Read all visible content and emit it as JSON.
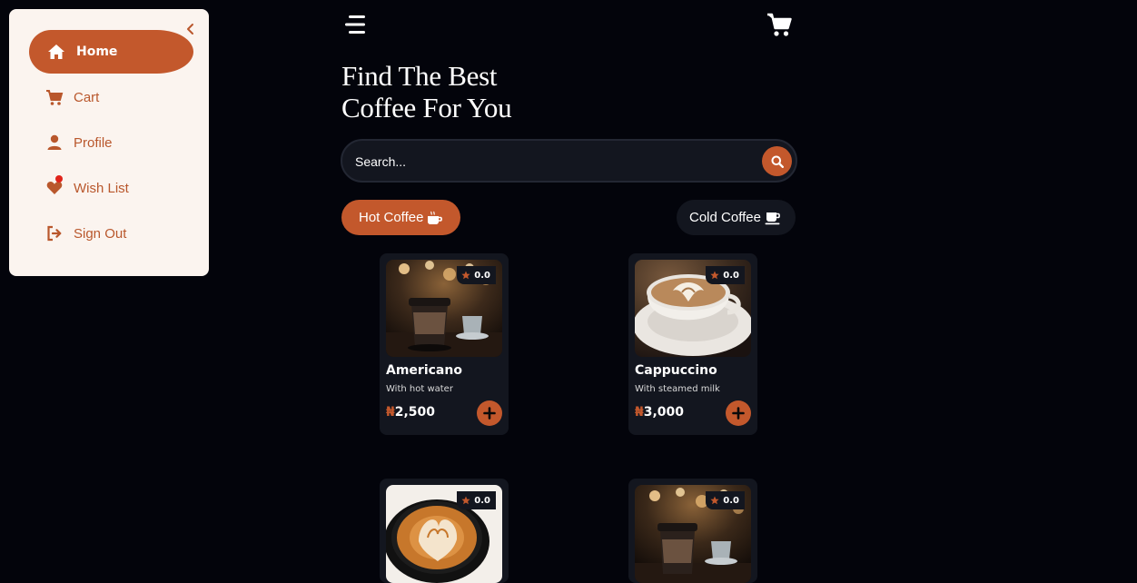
{
  "sidebar": {
    "items": [
      {
        "label": "Home",
        "icon": "home-icon",
        "active": true
      },
      {
        "label": "Cart",
        "icon": "cart-icon",
        "active": false
      },
      {
        "label": "Profile",
        "icon": "user-icon",
        "active": false
      },
      {
        "label": "Wish List",
        "icon": "heart-icon",
        "active": false
      },
      {
        "label": "Sign Out",
        "icon": "sign-out-icon",
        "active": false
      }
    ]
  },
  "header": {
    "title_line1": "Find The Best",
    "title_line2": "Coffee For You"
  },
  "search": {
    "placeholder": "Search..."
  },
  "categories": [
    {
      "label": "Hot Coffee",
      "icon": "mug-hot-icon",
      "active": true
    },
    {
      "label": "Cold Coffee",
      "icon": "mug-icon",
      "active": false
    }
  ],
  "products": [
    {
      "name": "Americano",
      "description": "With hot water",
      "currency": "₦",
      "price": "2,500",
      "rating": "0.0"
    },
    {
      "name": "Cappuccino",
      "description": "With steamed milk",
      "currency": "₦",
      "price": "3,000",
      "rating": "0.0"
    },
    {
      "rating": "0.0"
    },
    {
      "rating": "0.0"
    }
  ],
  "colors": {
    "accent": "#c3582c",
    "background": "#03040b",
    "surface": "#13161f",
    "sidebar_bg": "#fbf4ef",
    "notification": "#e0231a"
  }
}
